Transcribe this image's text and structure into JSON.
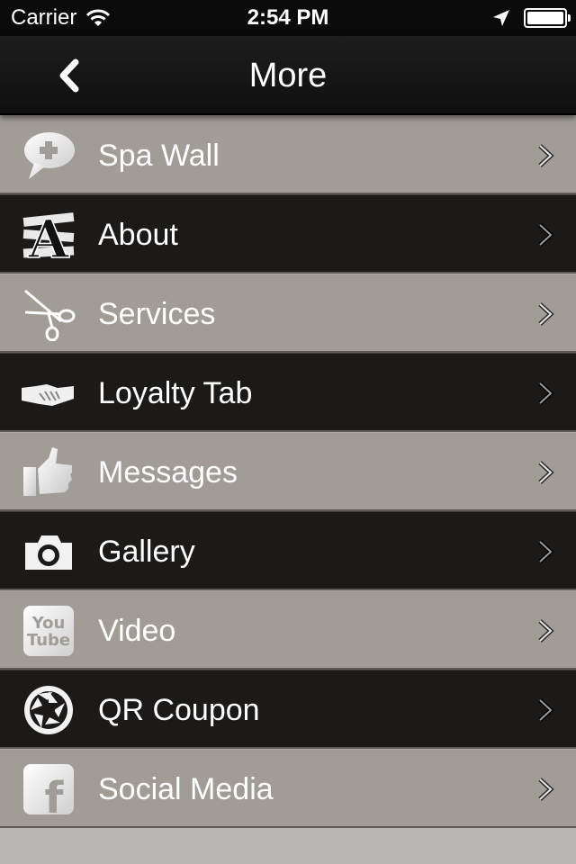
{
  "status_bar": {
    "carrier": "Carrier",
    "time": "2:54 PM"
  },
  "nav": {
    "title": "More"
  },
  "menu": {
    "items": [
      {
        "label": "Spa Wall",
        "icon": "chat-bubble-plus-icon"
      },
      {
        "label": "About",
        "icon": "letter-a-icon"
      },
      {
        "label": "Services",
        "icon": "scissors-icon"
      },
      {
        "label": "Loyalty Tab",
        "icon": "handshake-icon"
      },
      {
        "label": "Messages",
        "icon": "thumbs-up-icon"
      },
      {
        "label": "Gallery",
        "icon": "camera-icon"
      },
      {
        "label": "Video",
        "icon": "youtube-icon",
        "icon_text": [
          "You",
          "Tube"
        ]
      },
      {
        "label": "QR Coupon",
        "icon": "aperture-icon"
      },
      {
        "label": "Social Media",
        "icon": "facebook-icon",
        "icon_text": [
          "f"
        ]
      }
    ]
  },
  "colors": {
    "row_light": "#a19c96",
    "row_dark": "#1b1a19",
    "nav_bg": "#151515",
    "text": "#ffffff"
  }
}
